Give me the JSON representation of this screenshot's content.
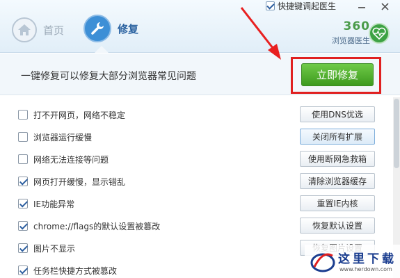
{
  "header": {
    "hotkey_label": "快捷键调起医生",
    "hotkey_checked": true,
    "tabs": [
      {
        "label": "首页",
        "icon": "house-icon",
        "active": false
      },
      {
        "label": "修复",
        "icon": "wrench-icon",
        "active": true
      }
    ],
    "brand": {
      "number": "360",
      "subtitle": "浏览器医生",
      "icon": "heart-pulse-icon"
    }
  },
  "action": {
    "title": "一键修复可以修复大部分浏览器常见问题",
    "button_label": "立即修复"
  },
  "items": [
    {
      "label": "打不开网页，网络不稳定",
      "checked": false,
      "button": "使用DNS优选"
    },
    {
      "label": "浏览器运行缓慢",
      "checked": false,
      "button": "关闭所有扩展"
    },
    {
      "label": "网络无法连接等问题",
      "checked": false,
      "button": "使用断网急救箱"
    },
    {
      "label": "网页打开缓慢，显示错乱",
      "checked": true,
      "button": "清除浏览器缓存"
    },
    {
      "label": "IE功能异常",
      "checked": true,
      "button": "重置IE内核"
    },
    {
      "label": "chrome://flags的默认设置被篡改",
      "checked": true,
      "button": "恢复默认设置"
    },
    {
      "label": "图片不显示",
      "checked": true,
      "button": "恢复图片设置"
    },
    {
      "label": "任务栏快捷方式被篡改",
      "checked": true,
      "button": ""
    }
  ],
  "watermark": {
    "text": "这里下载",
    "url": "www.herdown.com"
  },
  "colors": {
    "accent_green": "#4caf2e",
    "highlight_red": "#e02020",
    "header_blue": "#3d8fd6"
  }
}
